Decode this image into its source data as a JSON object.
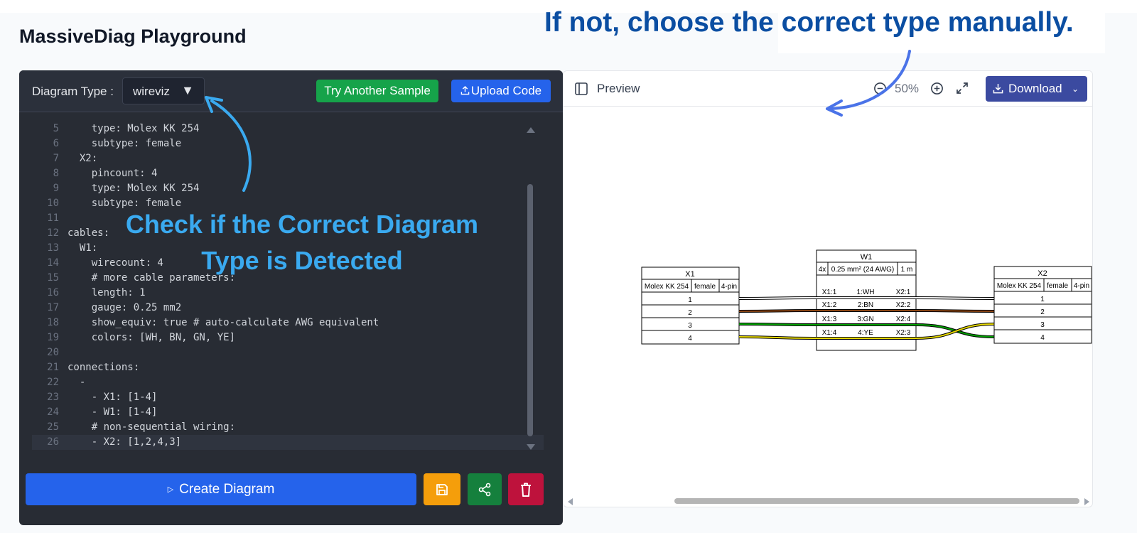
{
  "app": {
    "title": "MassiveDiag Playground"
  },
  "editor": {
    "diagram_type_label": "Diagram Type :",
    "diagram_type_value": "wireviz",
    "try_another_label": "Try Another Sample",
    "upload_label": "Upload Code",
    "create_label": "Create Diagram",
    "lines": [
      {
        "n": "5",
        "text": "    type: Molex KK 254"
      },
      {
        "n": "6",
        "text": "    subtype: female"
      },
      {
        "n": "7",
        "text": "  X2:"
      },
      {
        "n": "8",
        "text": "    pincount: 4"
      },
      {
        "n": "9",
        "text": "    type: Molex KK 254"
      },
      {
        "n": "10",
        "text": "    subtype: female"
      },
      {
        "n": "11",
        "text": ""
      },
      {
        "n": "12",
        "text": "cables:"
      },
      {
        "n": "13",
        "text": "  W1:"
      },
      {
        "n": "14",
        "text": "    wirecount: 4"
      },
      {
        "n": "15",
        "text": "    # more cable parameters:"
      },
      {
        "n": "16",
        "text": "    length: 1"
      },
      {
        "n": "17",
        "text": "    gauge: 0.25 mm2"
      },
      {
        "n": "18",
        "text": "    show_equiv: true # auto-calculate AWG equivalent"
      },
      {
        "n": "19",
        "text": "    colors: [WH, BN, GN, YE]"
      },
      {
        "n": "20",
        "text": ""
      },
      {
        "n": "21",
        "text": "connections:"
      },
      {
        "n": "22",
        "text": "  -"
      },
      {
        "n": "23",
        "text": "    - X1: [1-4]"
      },
      {
        "n": "24",
        "text": "    - W1: [1-4]"
      },
      {
        "n": "25",
        "text": "    # non-sequential wiring:"
      },
      {
        "n": "26",
        "text": "    - X2: [1,2,4,3]"
      }
    ]
  },
  "preview": {
    "label": "Preview",
    "zoom": "50%",
    "download_label": "Download",
    "diagram": {
      "x1": {
        "name": "X1",
        "type": "Molex KK 254",
        "subtype": "female",
        "pins": "4-pin",
        "rows": [
          "1",
          "2",
          "3",
          "4"
        ]
      },
      "x2": {
        "name": "X2",
        "type": "Molex KK 254",
        "subtype": "female",
        "pins": "4-pin",
        "rows": [
          "1",
          "2",
          "3",
          "4"
        ]
      },
      "w1": {
        "name": "W1",
        "count": "4x",
        "gauge": "0.25 mm² (24 AWG)",
        "length": "1 m",
        "wires": [
          {
            "from": "X1:1",
            "color": "1:WH",
            "to": "X2:1"
          },
          {
            "from": "X1:2",
            "color": "2:BN",
            "to": "X2:2"
          },
          {
            "from": "X1:3",
            "color": "3:GN",
            "to": "X2:4"
          },
          {
            "from": "X1:4",
            "color": "4:YE",
            "to": "X2:3"
          }
        ]
      }
    }
  },
  "annotations": {
    "top_right": "If not, choose the correct type manually.",
    "left_line1": "Check if the Correct Diagram",
    "left_line2": "Type is Detected"
  },
  "colors": {
    "editor_bg": "#282c34",
    "green_button": "#16a34a",
    "blue_button": "#2563eb",
    "save_button": "#f59e0b",
    "share_button": "#15803d",
    "delete_button": "#be123c",
    "download_button": "#3b4aa0",
    "annotation_dark_blue": "#0b4ea2",
    "annotation_light_blue": "#3aaaf0",
    "wire_white": "#ffffff",
    "wire_brown": "#8b4513",
    "wire_green": "#00a000",
    "wire_yellow": "#e6d800"
  },
  "icons": {
    "sidebar": "sidebar-toggle-icon",
    "zoom_out": "zoom-out-icon",
    "zoom_in": "zoom-in-icon",
    "fullscreen": "expand-icon",
    "download": "download-icon",
    "upload": "upload-icon",
    "save": "save-icon",
    "share": "share-icon",
    "delete": "trash-icon",
    "play": "play-icon"
  }
}
